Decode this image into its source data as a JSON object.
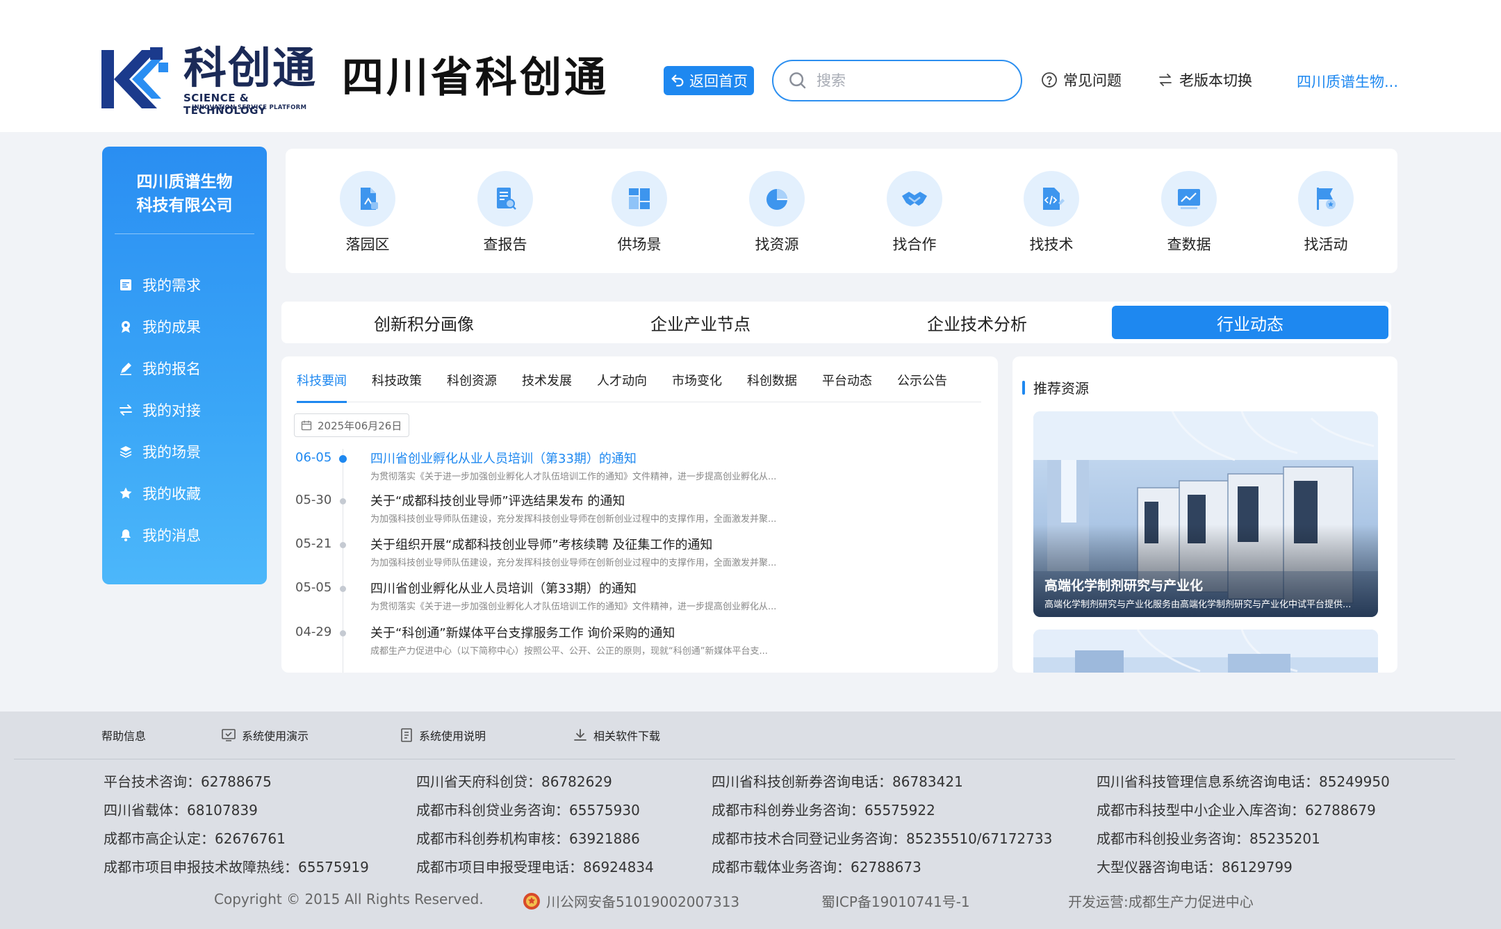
{
  "brand": {
    "logo_cn": "科创通",
    "logo_en1": "SCIENCE & TECHNOLOGY",
    "logo_en2": "INNOVATION SERVICE PLATFORM",
    "site_title": "四川省科创通"
  },
  "header": {
    "back_label": "返回首页",
    "search_placeholder": "搜索",
    "faq_label": "常见问题",
    "switch_label": "老版本切换",
    "user_label": "四川质谱生物..."
  },
  "sidebar": {
    "company": "四川质谱生物\n科技有限公司",
    "company_line1": "四川质谱生物",
    "company_line2": "科技有限公司",
    "items": [
      {
        "label": "我的需求",
        "icon": "demand-icon"
      },
      {
        "label": "我的成果",
        "icon": "achievement-icon"
      },
      {
        "label": "我的报名",
        "icon": "signup-icon"
      },
      {
        "label": "我的对接",
        "icon": "exchange-icon"
      },
      {
        "label": "我的场景",
        "icon": "layers-icon"
      },
      {
        "label": "我的收藏",
        "icon": "star-icon"
      },
      {
        "label": "我的消息",
        "icon": "bell-icon"
      }
    ]
  },
  "shortcuts": [
    {
      "label": "落园区",
      "icon": "park-icon"
    },
    {
      "label": "查报告",
      "icon": "report-icon"
    },
    {
      "label": "供场景",
      "icon": "scene-icon"
    },
    {
      "label": "找资源",
      "icon": "resource-icon"
    },
    {
      "label": "找合作",
      "icon": "handshake-icon"
    },
    {
      "label": "找技术",
      "icon": "tech-icon"
    },
    {
      "label": "查数据",
      "icon": "data-icon"
    },
    {
      "label": "找活动",
      "icon": "activity-icon"
    }
  ],
  "big_tabs": [
    "创新积分画像",
    "企业产业节点",
    "企业技术分析",
    "行业动态"
  ],
  "big_tab_active": "行业动态",
  "sub_tabs": [
    "科技要闻",
    "科技政策",
    "科创资源",
    "技术发展",
    "人才动向",
    "市场变化",
    "科创数据",
    "平台动态",
    "公示公告"
  ],
  "sub_tab_active": "科技要闻",
  "date_filter": "2025年06月26日",
  "news": [
    {
      "date": "06-05",
      "title": "四川省创业孵化从业人员培训（第33期）的通知",
      "summary": "为贯彻落实《关于进一步加强创业孵化人才队伍培训工作的通知》文件精神，进一步提高创业孵化从...",
      "active": true
    },
    {
      "date": "05-30",
      "title": "关于“成都科技创业导师”评选结果发布 的通知",
      "summary": "为加强科技创业导师队伍建设，充分发挥科技创业导师在创新创业过程中的支撑作用，全面激发并聚...",
      "active": false
    },
    {
      "date": "05-21",
      "title": "关于组织开展“成都科技创业导师”考核续聘 及征集工作的通知",
      "summary": "为加强科技创业导师队伍建设，充分发挥科技创业导师在创新创业过程中的支撑作用，全面激发并聚...",
      "active": false
    },
    {
      "date": "05-05",
      "title": "四川省创业孵化从业人员培训（第33期）的通知",
      "summary": "为贯彻落实《关于进一步加强创业孵化人才队伍培训工作的通知》文件精神，进一步提高创业孵化从...",
      "active": false
    },
    {
      "date": "04-29",
      "title": "关于“科创通”新媒体平台支撑服务工作 询价采购的通知",
      "summary": "成都生产力促进中心（以下简称中心）按照公平、公开、公正的原则，现就“科创通”新媒体平台支...",
      "active": false
    }
  ],
  "recommend": {
    "heading": "推荐资源",
    "cards": [
      {
        "title": "高端化学制剂研究与产业化",
        "desc": "高端化学制剂研究与产业化服务由高端化学制剂研究与产业化中试平台提供..."
      }
    ]
  },
  "footer": {
    "tabs": [
      {
        "label": "帮助信息",
        "icon": ""
      },
      {
        "label": "系统使用演示",
        "icon": "demo-icon"
      },
      {
        "label": "系统使用说明",
        "icon": "doc-icon"
      },
      {
        "label": "相关软件下载",
        "icon": "download-icon"
      }
    ],
    "columns": [
      [
        "平台技术咨询：62788675",
        "四川省载体：68107839",
        "成都市高企认定：62676761",
        "成都市项目申报技术故障热线：65575919"
      ],
      [
        "四川省天府科创贷：86782629",
        "成都市科创贷业务咨询：65575930",
        "成都市科创券机构审核：63921886",
        "成都市项目申报受理电话：86924834"
      ],
      [
        "四川省科技创新券咨询电话：86783421",
        "成都市科创券业务咨询：65575922",
        "成都市技术合同登记业务咨询：85235510/67172733",
        "成都市载体业务咨询：62788673"
      ],
      [
        "四川省科技管理信息系统咨询电话：85249950",
        "成都市科技型中小企业入库咨询：62788679",
        "成都市科创投业务咨询：85235201",
        "大型仪器咨询电话：86129799"
      ]
    ],
    "copyright": "Copyright © 2015 All Rights Reserved.",
    "police": "川公网安备51019002007313",
    "icp": "蜀ICP备19010741号-1",
    "operator": "开发运营:成都生产力促进中心"
  },
  "colors": {
    "primary": "#1e88f0",
    "sidebar_top": "#2a8ef2",
    "sidebar_bottom": "#4cb7fa",
    "footer_bg": "#dcdfe5"
  }
}
